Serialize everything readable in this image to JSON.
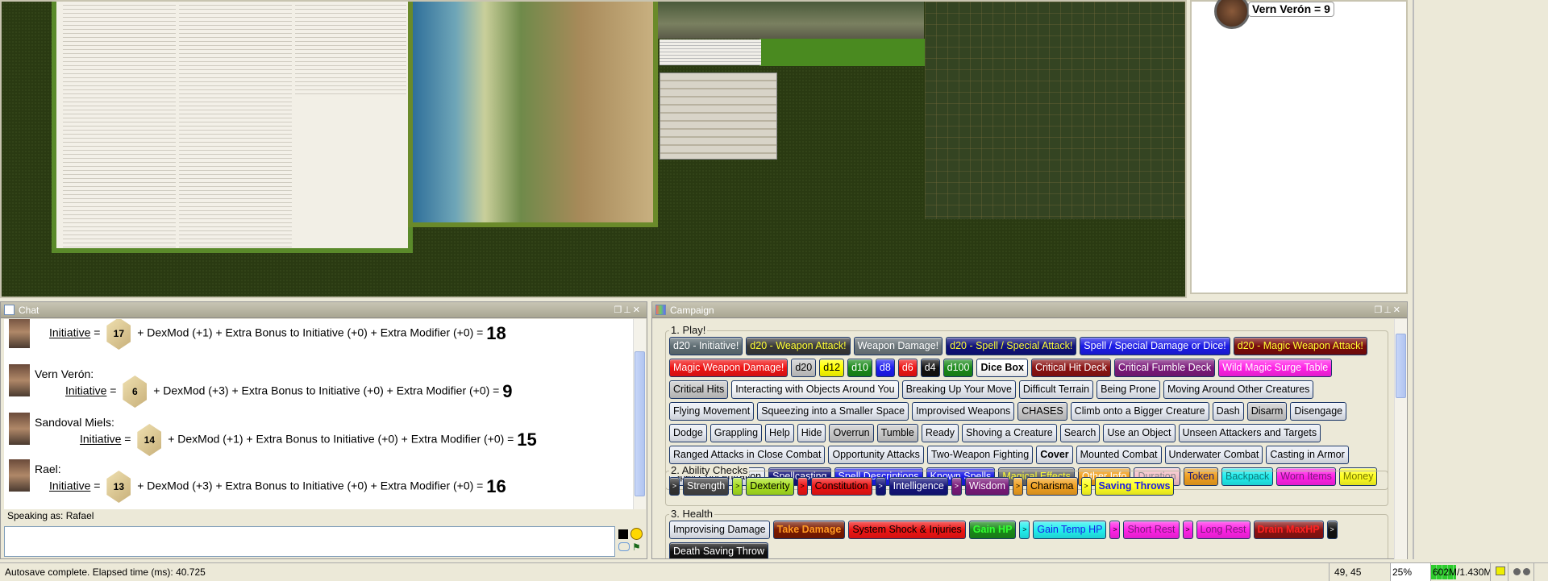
{
  "initiative_panel": {
    "entry": "Vern Verón = 9"
  },
  "chat": {
    "title": "Chat",
    "messages": [
      {
        "name": "",
        "label": "Initiative",
        "die": "17",
        "dexmod": "+ DexMod (+1) + Extra Bonus to Initiative (+0) + Extra Modifier (+0) =",
        "total": "18"
      },
      {
        "name": "Vern Verón:",
        "label": "Initiative",
        "die": "6",
        "dexmod": "+ DexMod (+3) + Extra Bonus to Initiative (+0) + Extra Modifier (+0) =",
        "total": "9"
      },
      {
        "name": "Sandoval Miels:",
        "label": "Initiative",
        "die": "14",
        "dexmod": "+ DexMod (+1) + Extra Bonus to Initiative (+0) + Extra Modifier (+0) =",
        "total": "15"
      },
      {
        "name": "Rael:",
        "label": "Initiative",
        "die": "13",
        "dexmod": "+ DexMod (+3) + Extra Bonus to Initiative (+0) + Extra Modifier (+0) =",
        "total": "16"
      }
    ],
    "speaking_as": "Speaking as: Rafael",
    "input_value": ""
  },
  "campaign": {
    "title": "Campaign",
    "groups": [
      {
        "title": "1. Play!",
        "buttons": [
          {
            "label": "d20 - Initiative!",
            "bg": "#5f6e74",
            "fg": "#ffffff"
          },
          {
            "label": "d20 - Weapon Attack!",
            "bg": "#383838",
            "fg": "#ffff33"
          },
          {
            "label": "Weapon Damage!",
            "bg": "#6d777c",
            "fg": "#ffffff"
          },
          {
            "label": "d20 - Spell / Special Attack!",
            "bg": "#10127a",
            "fg": "#ffff33"
          },
          {
            "label": "Spell / Special Damage or Dice!",
            "bg": "#1c1ce6",
            "fg": "#ffffff"
          },
          {
            "label": "d20 - Magic Weapon Attack!",
            "bg": "#7a0c0c",
            "fg": "#ffff33"
          },
          {
            "label": "Magic Weapon Damage!",
            "bg": "#ee1414",
            "fg": "#ffffff"
          },
          {
            "label": "d20",
            "bg": "#c8c8c8",
            "fg": "#000000"
          },
          {
            "label": "d12",
            "bg": "#ffff00",
            "fg": "#000000"
          },
          {
            "label": "d10",
            "bg": "#1a8a1a",
            "fg": "#ffffff"
          },
          {
            "label": "d8",
            "bg": "#1c1cf0",
            "fg": "#ffffff"
          },
          {
            "label": "d6",
            "bg": "#ee1414",
            "fg": "#ffffff"
          },
          {
            "label": "d4",
            "bg": "#111111",
            "fg": "#ffffff"
          },
          {
            "label": "d100",
            "bg": "#1a8a1a",
            "fg": "#ffffff"
          },
          {
            "label": "Dice Box",
            "bg": "#ffffff",
            "fg": "#000000",
            "bold": true
          },
          {
            "label": "Critical Hit Deck",
            "bg": "#8a1212",
            "fg": "#ffffff"
          },
          {
            "label": "Critical Fumble Deck",
            "bg": "#7a1a7a",
            "fg": "#ffffff"
          },
          {
            "label": "Wild Magic Surge Table",
            "bg": "#ff22e6",
            "fg": "#ffffff"
          },
          {
            "label": "Critical Hits",
            "bg": "#c8c8c8",
            "fg": "#000000"
          },
          {
            "label": "Interacting with Objects Around You",
            "bg": "#f4f6fa",
            "fg": "#000000"
          },
          {
            "label": "Breaking Up Your Move"
          },
          {
            "label": "Difficult Terrain"
          },
          {
            "label": "Being Prone"
          },
          {
            "label": "Moving Around Other Creatures"
          },
          {
            "label": "Flying Movement"
          },
          {
            "label": "Squeezing into a Smaller Space"
          },
          {
            "label": "Improvised Weapons"
          },
          {
            "label": "CHASES",
            "bg": "#c8c8c8",
            "fg": "#000000"
          },
          {
            "label": "Climb onto a Bigger Creature"
          },
          {
            "label": "Dash"
          },
          {
            "label": "Disarm",
            "bg": "#c8c8c8",
            "fg": "#000000"
          },
          {
            "label": "Disengage"
          },
          {
            "label": "Dodge"
          },
          {
            "label": "Grappling"
          },
          {
            "label": "Help"
          },
          {
            "label": "Hide"
          },
          {
            "label": "Overrun",
            "bg": "#c8c8c8",
            "fg": "#000000"
          },
          {
            "label": "Tumble",
            "bg": "#c8c8c8",
            "fg": "#000000"
          },
          {
            "label": "Ready"
          },
          {
            "label": "Shoving a Creature"
          },
          {
            "label": "Search"
          },
          {
            "label": "Use an Object"
          },
          {
            "label": "Unseen Attackers and Targets"
          },
          {
            "label": "Ranged Attacks in Close Combat"
          },
          {
            "label": "Opportunity Attacks"
          },
          {
            "label": "Two-Weapon Fighting"
          },
          {
            "label": "Cover",
            "bold": true
          },
          {
            "label": "Mounted Combat"
          },
          {
            "label": "Underwater Combat"
          },
          {
            "label": "Casting in Armor"
          },
          {
            "label": "Spell Concentration"
          },
          {
            "label": "Spellcasting",
            "bg": "#14147a",
            "fg": "#ffffff"
          },
          {
            "label": "Spell Descriptions",
            "bg": "#1c1ce6",
            "fg": "#ffffff"
          },
          {
            "label": "Known Spells",
            "bg": "#1c1ce6",
            "fg": "#ffffff"
          },
          {
            "label": "Magical Effects",
            "bg": "#6a6a6a",
            "fg": "#ffff33"
          },
          {
            "label": "Other Info",
            "bg": "#f0a020",
            "fg": "#ffffff"
          },
          {
            "label": "Duration",
            "bg": "#f4c0c8",
            "fg": "#888888"
          },
          {
            "label": "Token",
            "bg": "#f0a020",
            "fg": "#14147a"
          },
          {
            "label": "Backpack",
            "bg": "#22eeee",
            "fg": "#117777"
          },
          {
            "label": "Worn Items",
            "bg": "#ff22e6",
            "fg": "#7a1a7a"
          },
          {
            "label": "Money",
            "bg": "#ffff22",
            "fg": "#777700"
          }
        ]
      },
      {
        "title": "2. Ability Checks",
        "buttons": [
          {
            "label": ">",
            "bg": "#333333",
            "fg": "#ffffff",
            "small": true
          },
          {
            "label": "Strength",
            "bg": "#444444",
            "fg": "#ffffff"
          },
          {
            "label": ">",
            "bg": "#a8e020",
            "fg": "#000000",
            "small": true
          },
          {
            "label": "Dexterity",
            "bg": "#a8e020",
            "fg": "#000000"
          },
          {
            "label": ">",
            "bg": "#ee1414",
            "fg": "#000000",
            "small": true
          },
          {
            "label": "Constitution",
            "bg": "#ee1414",
            "fg": "#000000"
          },
          {
            "label": ">",
            "bg": "#14147a",
            "fg": "#ffffff",
            "small": true
          },
          {
            "label": "Intelligence",
            "bg": "#14147a",
            "fg": "#ffffff"
          },
          {
            "label": ">",
            "bg": "#7a1a7a",
            "fg": "#ffffff",
            "small": true
          },
          {
            "label": "Wisdom",
            "bg": "#7a1a7a",
            "fg": "#ffffff"
          },
          {
            "label": ">",
            "bg": "#f0a020",
            "fg": "#000000",
            "small": true
          },
          {
            "label": "Charisma",
            "bg": "#f0a020",
            "fg": "#000000"
          },
          {
            "label": ">",
            "bg": "#ffff22",
            "fg": "#000000",
            "small": true
          },
          {
            "label": "Saving Throws",
            "bg": "#ffff22",
            "fg": "#1c1ce6",
            "bold": true
          }
        ]
      },
      {
        "title": "3. Health",
        "buttons": [
          {
            "label": "Improvising Damage"
          },
          {
            "label": "Take Damage",
            "bg": "#7a1a00",
            "fg": "#ff9922",
            "bold": true
          },
          {
            "label": "System Shock & Injuries",
            "bg": "#ee1414",
            "fg": "#000000"
          },
          {
            "label": "Gain HP",
            "bg": "#1a8a1a",
            "fg": "#33ff33",
            "bold": true
          },
          {
            "label": ">",
            "bg": "#22eeee",
            "fg": "#000000",
            "small": true
          },
          {
            "label": "Gain Temp HP",
            "bg": "#22eeee",
            "fg": "#1c1ce6"
          },
          {
            "label": ">",
            "bg": "#ff22e6",
            "fg": "#000000",
            "small": true
          },
          {
            "label": "Short Rest",
            "bg": "#ff22e6",
            "fg": "#7a1a7a"
          },
          {
            "label": ">",
            "bg": "#ff22e6",
            "fg": "#000000",
            "small": true
          },
          {
            "label": "Long Rest",
            "bg": "#ff22e6",
            "fg": "#7a1a7a"
          },
          {
            "label": "Drain MaxHP",
            "bg": "#8a1212",
            "fg": "#ff2222",
            "bold": true
          },
          {
            "label": ">",
            "bg": "#111111",
            "fg": "#ffffff",
            "small": true
          },
          {
            "label": "Death Saving Throw",
            "bg": "#111111",
            "fg": "#ffffff"
          }
        ]
      }
    ]
  },
  "status_bar": {
    "message": "Autosave complete.  Elapsed time (ms): 40.725",
    "coords": "49, 45",
    "zoom": "25%",
    "memory": "602M/1.430M",
    "memory_used_fraction": 0.42
  }
}
